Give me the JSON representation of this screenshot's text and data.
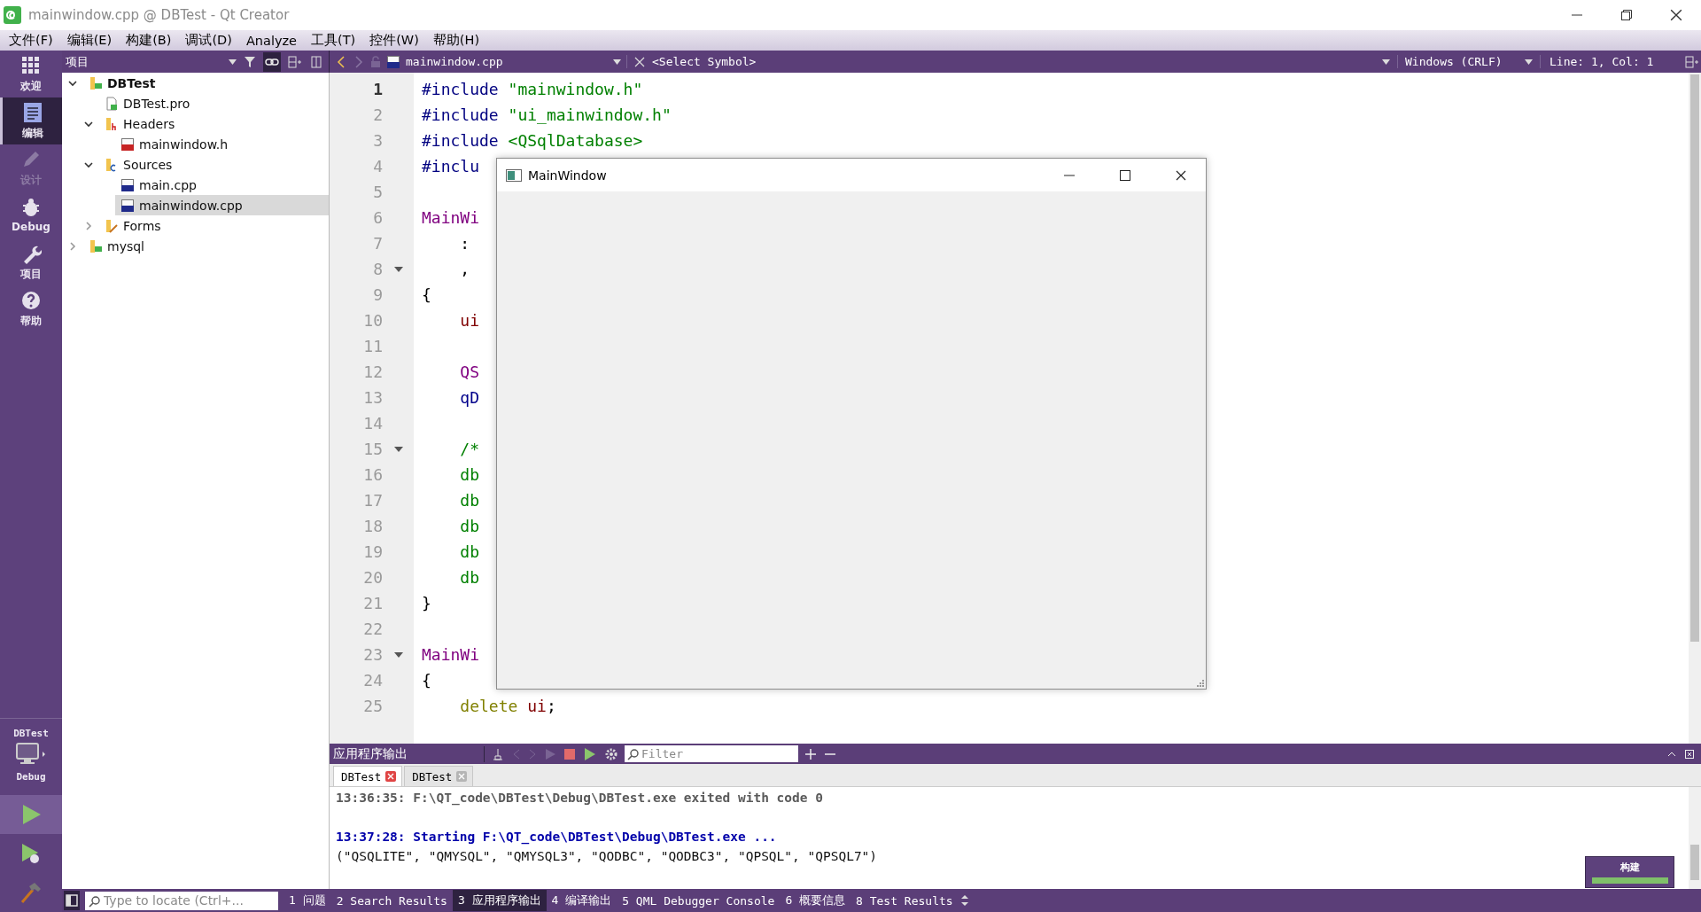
{
  "window": {
    "title": "mainwindow.cpp @ DBTest - Qt Creator"
  },
  "menu": [
    "文件(F)",
    "编辑(E)",
    "构建(B)",
    "调试(D)",
    "Analyze",
    "工具(T)",
    "控件(W)",
    "帮助(H)"
  ],
  "modes": [
    {
      "label": "欢迎",
      "kind": "welcome",
      "selected": false,
      "disabled": false
    },
    {
      "label": "编辑",
      "kind": "edit",
      "selected": true,
      "disabled": false
    },
    {
      "label": "设计",
      "kind": "design",
      "selected": false,
      "disabled": true
    },
    {
      "label": "Debug",
      "kind": "debug",
      "selected": false,
      "disabled": false
    },
    {
      "label": "项目",
      "kind": "projects",
      "selected": false,
      "disabled": false
    },
    {
      "label": "帮助",
      "kind": "help",
      "selected": false,
      "disabled": false
    }
  ],
  "target": {
    "project": "DBTest",
    "config": "Debug"
  },
  "actions": [
    {
      "kind": "run",
      "highlighted": true
    },
    {
      "kind": "debug-run",
      "highlighted": false
    },
    {
      "kind": "build",
      "highlighted": false
    }
  ],
  "project_pane": {
    "title": "项目"
  },
  "tree": [
    {
      "label": "DBTest",
      "kind": "project",
      "active": true,
      "expanded": true,
      "selected": false,
      "children": [
        {
          "label": "DBTest.pro",
          "kind": "pro",
          "selected": false
        },
        {
          "label": "Headers",
          "kind": "headers",
          "expanded": true,
          "selected": false,
          "children": [
            {
              "label": "mainwindow.h",
              "kind": "h",
              "selected": false
            }
          ]
        },
        {
          "label": "Sources",
          "kind": "sources",
          "expanded": true,
          "selected": false,
          "children": [
            {
              "label": "main.cpp",
              "kind": "cpp",
              "selected": false
            },
            {
              "label": "mainwindow.cpp",
              "kind": "cpp",
              "selected": true
            }
          ]
        },
        {
          "label": "Forms",
          "kind": "forms",
          "expanded": false,
          "selected": false
        }
      ]
    },
    {
      "label": "mysql",
      "kind": "project",
      "active": false,
      "expanded": false,
      "selected": false
    }
  ],
  "editor_toolbar": {
    "file": "mainwindow.cpp",
    "symbol": "<Select Symbol>",
    "line_ending": "Windows (CRLF)",
    "position": "Line: 1, Col: 1"
  },
  "code_lines": [
    {
      "number": "1",
      "current": true,
      "fold": false,
      "tokens": [
        {
          "text": "#include ",
          "kind": "pre"
        },
        {
          "text": "\"mainwindow.h\"",
          "kind": "str"
        }
      ]
    },
    {
      "number": "2",
      "current": false,
      "fold": false,
      "tokens": [
        {
          "text": "#include ",
          "kind": "pre"
        },
        {
          "text": "\"ui_mainwindow.h\"",
          "kind": "str"
        }
      ]
    },
    {
      "number": "3",
      "current": false,
      "fold": false,
      "tokens": [
        {
          "text": "#include ",
          "kind": "pre"
        },
        {
          "text": "<QSqlDatabase>",
          "kind": "str"
        }
      ]
    },
    {
      "number": "4",
      "current": false,
      "fold": false,
      "tokens": [
        {
          "text": "#inclu",
          "kind": "pre"
        }
      ]
    },
    {
      "number": "5",
      "current": false,
      "fold": false
    },
    {
      "number": "6",
      "current": false,
      "fold": false,
      "tokens": [
        {
          "text": "MainWi",
          "kind": "type"
        }
      ]
    },
    {
      "number": "7",
      "current": false,
      "fold": false,
      "tokens": [
        {
          "text": "    :",
          "kind": "plain"
        }
      ]
    },
    {
      "number": "8",
      "current": false,
      "fold": true,
      "tokens": [
        {
          "text": "    ,",
          "kind": "plain"
        }
      ]
    },
    {
      "number": "9",
      "current": false,
      "fold": false,
      "tokens": [
        {
          "text": "{",
          "kind": "plain"
        }
      ]
    },
    {
      "number": "10",
      "current": false,
      "fold": false,
      "tokens": [
        {
          "text": "    ui",
          "kind": "member"
        }
      ]
    },
    {
      "number": "11",
      "current": false,
      "fold": false
    },
    {
      "number": "12",
      "current": false,
      "fold": false,
      "tokens": [
        {
          "text": "    QS",
          "kind": "type"
        }
      ]
    },
    {
      "number": "13",
      "current": false,
      "fold": false,
      "tokens": [
        {
          "text": "    qD",
          "kind": "func"
        }
      ]
    },
    {
      "number": "14",
      "current": false,
      "fold": false
    },
    {
      "number": "15",
      "current": false,
      "fold": true,
      "tokens": [
        {
          "text": "    /*",
          "kind": "comment"
        }
      ]
    },
    {
      "number": "16",
      "current": false,
      "fold": false,
      "tokens": [
        {
          "text": "    db",
          "kind": "comment"
        }
      ]
    },
    {
      "number": "17",
      "current": false,
      "fold": false,
      "tokens": [
        {
          "text": "    db",
          "kind": "comment"
        }
      ]
    },
    {
      "number": "18",
      "current": false,
      "fold": false,
      "tokens": [
        {
          "text": "    db",
          "kind": "comment"
        }
      ]
    },
    {
      "number": "19",
      "current": false,
      "fold": false,
      "tokens": [
        {
          "text": "    db",
          "kind": "comment"
        }
      ]
    },
    {
      "number": "20",
      "current": false,
      "fold": false,
      "tokens": [
        {
          "text": "    db",
          "kind": "comment"
        }
      ]
    },
    {
      "number": "21",
      "current": false,
      "fold": false,
      "tokens": [
        {
          "text": "}",
          "kind": "plain"
        }
      ]
    },
    {
      "number": "22",
      "current": false,
      "fold": false
    },
    {
      "number": "23",
      "current": false,
      "fold": true,
      "tokens": [
        {
          "text": "MainWi",
          "kind": "type"
        }
      ]
    },
    {
      "number": "24",
      "current": false,
      "fold": false,
      "tokens": [
        {
          "text": "{",
          "kind": "plain"
        }
      ]
    },
    {
      "number": "25",
      "current": false,
      "fold": false,
      "tokens": [
        {
          "text": "    delete",
          "kind": "keyword"
        },
        {
          "text": " ui",
          "kind": "member"
        },
        {
          "text": ";",
          "kind": "plain"
        }
      ]
    }
  ],
  "app_window": {
    "title": "MainWindow"
  },
  "output": {
    "title": "应用程序输出",
    "filter_placeholder": "Filter",
    "tabs": [
      {
        "label": "DBTest",
        "selected": true
      },
      {
        "label": "DBTest",
        "selected": false
      }
    ],
    "lines": [
      {
        "kind": "exit",
        "text": "13:36:35: F:\\QT_code\\DBTest\\Debug\\DBTest.exe exited with code 0"
      },
      {
        "kind": "blank"
      },
      {
        "kind": "start",
        "text": "13:37:28: Starting F:\\QT_code\\DBTest\\Debug\\DBTest.exe ..."
      },
      {
        "kind": "plain",
        "text": "(\"QSQLITE\", \"QMYSQL\", \"QMYSQL3\", \"QODBC\", \"QODBC3\", \"QPSQL\", \"QPSQL7\")"
      }
    ]
  },
  "status_bar": {
    "locate_placeholder": "Type to locate (Ctrl+...",
    "panes": [
      {
        "label": "1 问题",
        "selected": false
      },
      {
        "label": "2 Search Results",
        "selected": false
      },
      {
        "label": "3 应用程序输出",
        "selected": true
      },
      {
        "label": "4 编译输出",
        "selected": false
      },
      {
        "label": "5 QML Debugger Console",
        "selected": false
      },
      {
        "label": "6 概要信息",
        "selected": false
      },
      {
        "label": "8 Test Results",
        "selected": false
      }
    ],
    "build": {
      "label": "构建",
      "level": 1
    }
  }
}
